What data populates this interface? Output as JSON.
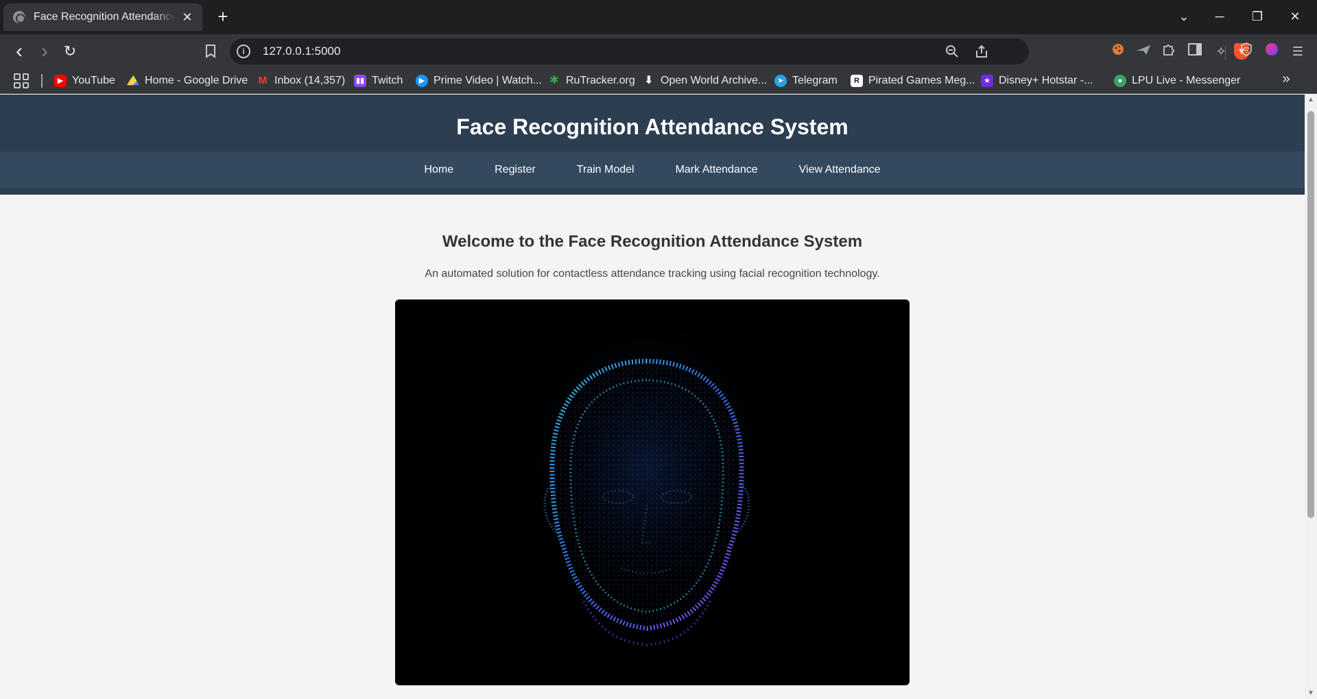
{
  "browser": {
    "tab_title": "Face Recognition Attendance System",
    "tab_close": "✕",
    "new_tab": "+",
    "url": "127.0.0.1:5000",
    "window_controls": {
      "tab_list": "⌄",
      "minimize": "─",
      "restore": "❐",
      "close": "✕"
    },
    "nav": {
      "back": "‹",
      "forward": "›",
      "reload": "↻"
    },
    "bookmarks": [
      {
        "label": "YouTube",
        "icon": "youtube-icon",
        "color": "#ff0000"
      },
      {
        "label": "Home - Google Drive",
        "icon": "google-drive-icon",
        "color": "#1fa463"
      },
      {
        "label": "Inbox (14,357)",
        "icon": "gmail-icon",
        "color": "#ea4335"
      },
      {
        "label": "Twitch",
        "icon": "twitch-icon",
        "color": "#9146ff"
      },
      {
        "label": "Prime Video | Watch...",
        "icon": "prime-video-icon",
        "color": "#1a98ff"
      },
      {
        "label": "RuTracker.org",
        "icon": "rutracker-icon",
        "color": "#3aa34a"
      },
      {
        "label": "Open World Archive...",
        "icon": "download-icon",
        "color": "#202124"
      },
      {
        "label": "Telegram",
        "icon": "telegram-icon",
        "color": "#2aa3df"
      },
      {
        "label": "Pirated Games Meg...",
        "icon": "pirated-games-icon",
        "color": "#ffffff"
      },
      {
        "label": "Disney+ Hotstar -...",
        "icon": "hotstar-icon",
        "color": "#6f2bd9"
      },
      {
        "label": "LPU Live - Messenger",
        "icon": "lpu-live-icon",
        "color": "#3aa36b"
      }
    ],
    "bookmarks_more": "»"
  },
  "site": {
    "title": "Face Recognition Attendance System",
    "nav": [
      "Home",
      "Register",
      "Train Model",
      "Mark Attendance",
      "View Attendance"
    ],
    "welcome_heading": "Welcome to the Face Recognition Attendance System",
    "welcome_text": "An automated solution for contactless attendance tracking using facial recognition technology."
  },
  "colors": {
    "header": "#2c3e50",
    "nav": "#34495e",
    "page_bg": "#f4f4f4",
    "hero_bg": "#000000",
    "face_dots": "#3aa0e8"
  }
}
